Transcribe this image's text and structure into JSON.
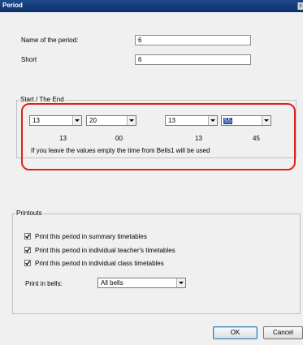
{
  "window": {
    "title": "Period"
  },
  "name_row": {
    "label": "Name of the period:",
    "value": "6"
  },
  "short_row": {
    "label": "Short",
    "value": "6"
  },
  "start_end": {
    "legend": "Start / The End",
    "start_hour": "13",
    "start_minute": "20",
    "end_hour": "13",
    "end_minute": "55",
    "start_hint_hour": "13",
    "start_hint_minute": "00",
    "end_hint_hour": "13",
    "end_hint_minute": "45",
    "note": "If you leave the values empty the time from Bells1 will be used"
  },
  "printouts": {
    "legend": "Printouts",
    "options": [
      {
        "label": "Print this period in summary timetables",
        "checked": true
      },
      {
        "label": "Print this period in individual teacher's timetables",
        "checked": true
      },
      {
        "label": "Print this period in individual class timetables",
        "checked": true
      }
    ],
    "bells_label": "Print in bells:",
    "bells_value": "All bells"
  },
  "buttons": {
    "ok": "OK",
    "cancel": "Cancel"
  },
  "colors": {
    "titlebar": "#0b2f6a",
    "highlight_box": "#e02020",
    "selection": "#1f47a8"
  }
}
